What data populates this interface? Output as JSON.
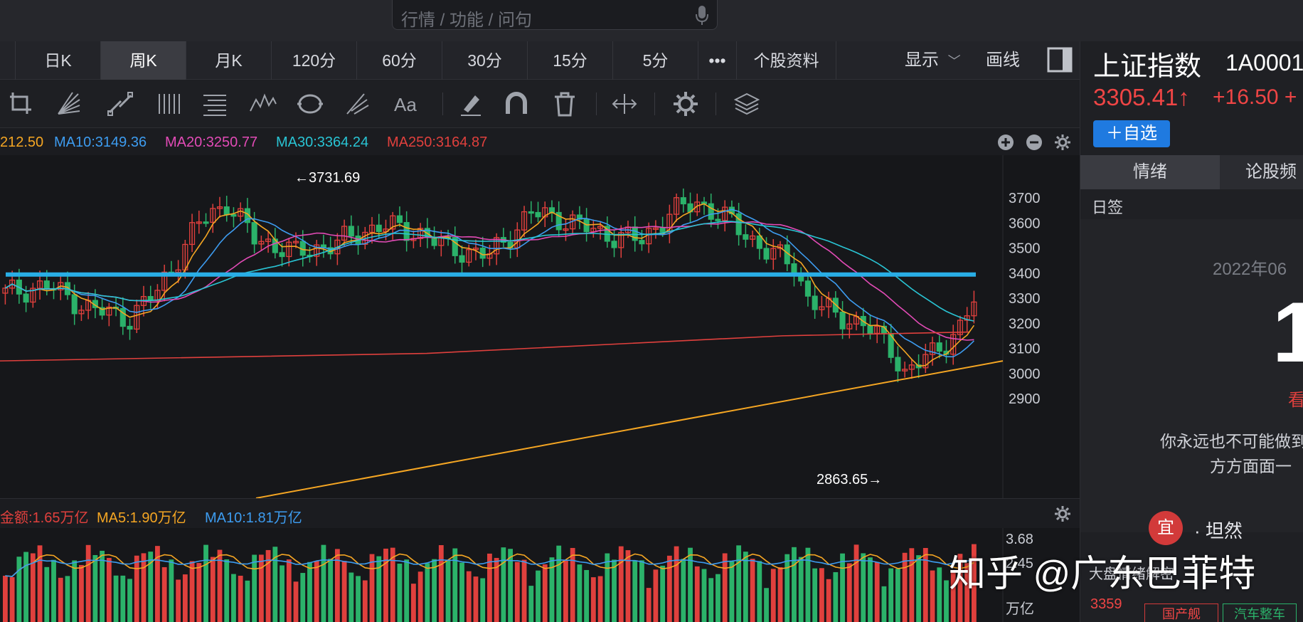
{
  "search": {
    "placeholder": "行情 / 功能 / 问句"
  },
  "tabs": [
    {
      "label": "日K"
    },
    {
      "label": "周K"
    },
    {
      "label": "月K"
    },
    {
      "label": "120分"
    },
    {
      "label": "60分"
    },
    {
      "label": "30分"
    },
    {
      "label": "15分"
    },
    {
      "label": "5分"
    },
    {
      "label": "•••"
    },
    {
      "label": "个股资料"
    }
  ],
  "active_tab": "周K",
  "toolbar": {
    "show_label": "显示",
    "draw_label": "画线"
  },
  "tools": [
    "crop-icon",
    "fan-lines-icon",
    "parallel-line-icon",
    "vertical-lines-icon",
    "text-lines-icon",
    "wave-icon",
    "cycle-icon",
    "fork-icon",
    "text-icon",
    "eraser-icon",
    "magnet-icon",
    "trash-icon",
    "measure-icon",
    "settings-icon",
    "layers-icon"
  ],
  "ma_legend": [
    {
      "label": "212.50",
      "color": "#f5a623"
    },
    {
      "label": "MA10:3149.36",
      "color": "#3d9cf0"
    },
    {
      "label": "MA20:3250.77",
      "color": "#e24bb6"
    },
    {
      "label": "MA30:3364.24",
      "color": "#29c4d4"
    },
    {
      "label": "MA250:3164.87",
      "color": "#e0403d"
    }
  ],
  "price_axis": [
    "3700",
    "3600",
    "3500",
    "3400",
    "3300",
    "3200",
    "3100",
    "3000",
    "2900"
  ],
  "annotations": {
    "high": "←3731.69",
    "low": "2863.65→"
  },
  "vol_legend": [
    {
      "label": "金额:1.65万亿",
      "color": "#e0403d"
    },
    {
      "label": "MA5:1.90万亿",
      "color": "#f5a623"
    },
    {
      "label": "MA10:1.81万亿",
      "color": "#3d9cf0"
    }
  ],
  "vol_axis": {
    "top": "3.68",
    "mid": "2.45",
    "unit": "万亿"
  },
  "colors": {
    "up": "#e0403d",
    "down": "#2bb26a",
    "accent": "#1f7ae0",
    "line": "#29aee6"
  },
  "right": {
    "name": "上证指数",
    "code": "1A0001",
    "price": "3305.41↑",
    "change": "+16.50 +",
    "add_watch": "＋自选",
    "tabs": [
      "情绪",
      "论股频"
    ],
    "daily_label": "日签",
    "card_date": "2022年06",
    "card_day": "1",
    "card_weekday": "看",
    "quote1": "你永远也不可能做到",
    "quote2": "方方面面一",
    "yi": "宜",
    "yi_text": "· 坦然",
    "mood": "大盘情绪解密",
    "mood_value": "3359",
    "tag1": "国产舰",
    "tag2": "汽车整车"
  },
  "watermark": "知乎 @广东巴菲特",
  "chart_data": {
    "type": "candlestick",
    "y_axis": {
      "min": 2850,
      "max": 3760,
      "ticks": [
        3700,
        3600,
        3500,
        3400,
        3300,
        3200,
        3100,
        3000,
        2900
      ]
    },
    "high_annotation": 3731.69,
    "low_annotation": 2863.65,
    "horizontal_line": 3400,
    "ma_values": {
      "MA10": 3149.36,
      "MA20": 3250.77,
      "MA30": 3364.24,
      "MA250": 3164.87
    }
  }
}
